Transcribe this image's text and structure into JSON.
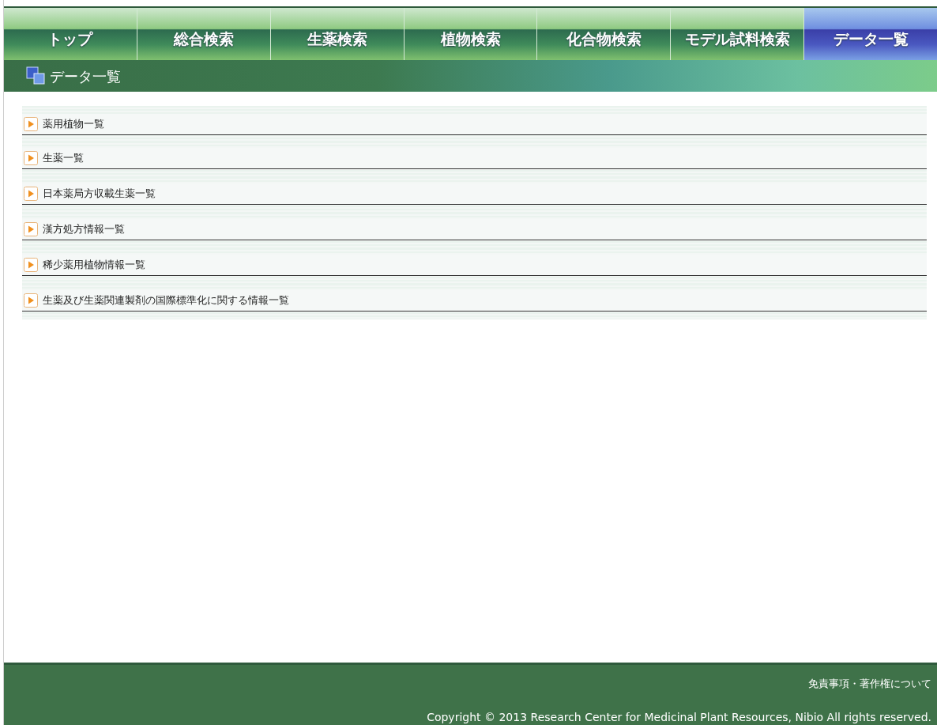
{
  "nav_tabs": [
    {
      "label": "トップ",
      "selected": false
    },
    {
      "label": "総合検索",
      "selected": false
    },
    {
      "label": "生薬検索",
      "selected": false
    },
    {
      "label": "植物検索",
      "selected": false
    },
    {
      "label": "化合物検索",
      "selected": false
    },
    {
      "label": "モデル試料検索",
      "selected": false
    },
    {
      "label": "データ一覧",
      "selected": true
    }
  ],
  "page_heading": "データ一覧",
  "list_items": [
    {
      "label": "薬用植物一覧"
    },
    {
      "label": "生薬一覧"
    },
    {
      "label": "日本薬局方収載生薬一覧"
    },
    {
      "label": "漢方処方情報一覧"
    },
    {
      "label": "稀少薬用植物情報一覧"
    },
    {
      "label": "生薬及び生薬関連製剤の国際標準化に関する情報一覧"
    }
  ],
  "footer": {
    "link": "免責事項・著作権について",
    "copyright": "Copyright © 2013 Research Center for Medicinal Plant Resources, Nibio All rights reserved."
  }
}
